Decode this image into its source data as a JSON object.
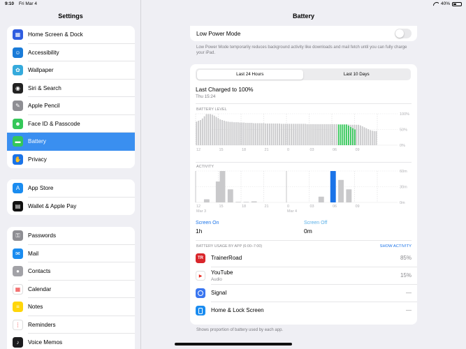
{
  "status": {
    "time": "9:10",
    "date": "Fri Mar 4",
    "battery_pct": "40%",
    "battery_level": 0.4
  },
  "sidebar": {
    "title": "Settings",
    "group1": [
      {
        "label": "Home Screen & Dock",
        "icon": "home-screen-icon",
        "color": "#2f5de0"
      },
      {
        "label": "Accessibility",
        "icon": "accessibility-icon",
        "color": "#1a7bd8"
      },
      {
        "label": "Wallpaper",
        "icon": "wallpaper-icon",
        "color": "#35aadc"
      },
      {
        "label": "Siri & Search",
        "icon": "siri-icon",
        "color": "#222222"
      },
      {
        "label": "Apple Pencil",
        "icon": "pencil-icon",
        "color": "#8e8e93"
      },
      {
        "label": "Face ID & Passcode",
        "icon": "face-id-icon",
        "color": "#34c759"
      },
      {
        "label": "Battery",
        "icon": "battery-icon",
        "color": "#34c759",
        "active": true
      },
      {
        "label": "Privacy",
        "icon": "hand-icon",
        "color": "#1a73e8"
      }
    ],
    "group2": [
      {
        "label": "App Store",
        "icon": "app-store-icon",
        "color": "#1a8cf0"
      },
      {
        "label": "Wallet & Apple Pay",
        "icon": "wallet-icon",
        "color": "#111111"
      }
    ],
    "group3": [
      {
        "label": "Passwords",
        "icon": "key-icon",
        "color": "#8e8e93"
      },
      {
        "label": "Mail",
        "icon": "mail-icon",
        "color": "#1a8cf0"
      },
      {
        "label": "Contacts",
        "icon": "contacts-icon",
        "color": "#a2a2a7"
      },
      {
        "label": "Calendar",
        "icon": "calendar-icon",
        "color": "#ffffff"
      },
      {
        "label": "Notes",
        "icon": "notes-icon",
        "color": "#ffd60a"
      },
      {
        "label": "Reminders",
        "icon": "reminders-icon",
        "color": "#ffffff"
      },
      {
        "label": "Voice Memos",
        "icon": "voice-memos-icon",
        "color": "#1c1c1e"
      }
    ]
  },
  "main": {
    "title": "Battery",
    "low_power": {
      "label": "Low Power Mode",
      "enabled": false,
      "note": "Low Power Mode temporarily reduces background activity like downloads and mail fetch until you can fully charge your iPad."
    },
    "tabs": [
      {
        "label": "Last 24 Hours",
        "selected": true
      },
      {
        "label": "Last 10 Days",
        "selected": false
      }
    ],
    "last_charged": "Last Charged to 100%",
    "last_charged_time": "Thu 15:24",
    "battery_level_label": "BATTERY LEVEL",
    "activity_label": "ACTIVITY",
    "screen_on_label": "Screen On",
    "screen_on_value": "1h",
    "screen_off_label": "Screen Off",
    "screen_off_value": "0m",
    "usage_header": "BATTERY USAGE BY APP (6:00–7:00)",
    "show_activity": "SHOW ACTIVITY",
    "apps": [
      {
        "name": "TrainerRoad",
        "sub": "",
        "pct": "85%",
        "icon": "trainerroad-icon",
        "color": "#d9262b",
        "glyph": "TR"
      },
      {
        "name": "YouTube",
        "sub": "Audio",
        "pct": "15%",
        "icon": "youtube-icon",
        "color": "#ffffff",
        "glyph": "▶"
      },
      {
        "name": "Signal",
        "sub": "",
        "pct": "—",
        "icon": "signal-icon",
        "color": "#3a76f0",
        "glyph": ""
      },
      {
        "name": "Home & Lock Screen",
        "sub": "",
        "pct": "—",
        "icon": "home-lock-icon",
        "color": "#1a8cf0",
        "glyph": ""
      }
    ],
    "foot_note": "Shows proportion of battery used by each app."
  },
  "chart_data": [
    {
      "type": "bar",
      "title": "BATTERY LEVEL",
      "x_ticks": [
        "12",
        "15",
        "18",
        "21",
        "0",
        "03",
        "06",
        "09"
      ],
      "y_ticks": [
        "100%",
        "50%",
        "0%"
      ],
      "ylim": [
        0,
        100
      ],
      "grid": true,
      "series": [
        {
          "values": [
            75,
            78,
            80,
            85,
            92,
            99,
            99,
            99,
            97,
            94,
            90,
            86,
            82,
            80,
            78,
            76,
            75,
            74,
            74,
            73,
            73,
            73,
            72,
            72,
            72,
            71,
            71,
            71,
            71,
            70,
            70,
            70,
            70,
            70,
            70,
            69,
            69,
            69,
            69,
            69,
            69,
            69,
            69,
            68,
            68,
            68,
            68,
            68,
            68,
            68,
            68,
            68,
            68,
            68,
            68,
            68,
            67,
            67,
            67,
            67,
            67,
            67,
            67,
            67,
            67,
            67,
            67,
            67,
            67,
            67,
            67,
            67,
            66,
            66,
            66,
            66,
            66,
            66,
            65,
            65,
            65,
            65,
            65,
            63,
            60,
            57,
            54,
            51,
            48,
            46,
            45,
            45
          ]
        }
      ],
      "charging_range": [
        5,
        7
      ],
      "highlight_range": [
        72,
        84
      ]
    },
    {
      "type": "bar",
      "title": "ACTIVITY",
      "x_ticks": [
        "12",
        "15",
        "18",
        "21",
        "0",
        "03",
        "06",
        "09"
      ],
      "date_labels": [
        "Mar 3",
        "Mar 4"
      ],
      "y_ticks": [
        "60m",
        "30m",
        "0m"
      ],
      "ylim": [
        0,
        60
      ],
      "grid": true,
      "series": [
        {
          "name": "Screen On",
          "values": [
            0,
            0,
            5,
            0,
            0,
            0,
            0,
            0,
            0,
            0,
            0,
            0,
            0,
            0,
            0,
            0,
            0,
            0,
            0,
            0,
            0,
            0,
            0,
            0
          ],
          "comment": "light bars"
        }
      ],
      "bars": [
        0,
        0,
        6,
        0,
        0,
        40,
        60,
        0,
        25,
        0,
        1,
        0,
        1,
        0,
        2,
        0,
        0,
        0,
        0,
        0,
        0,
        0,
        0,
        0,
        0,
        0,
        0,
        0,
        0,
        0,
        0,
        11,
        0,
        0,
        60,
        0,
        43,
        0,
        25,
        0,
        0,
        0,
        0,
        0,
        0,
        0
      ],
      "highlight_index": 34
    }
  ]
}
